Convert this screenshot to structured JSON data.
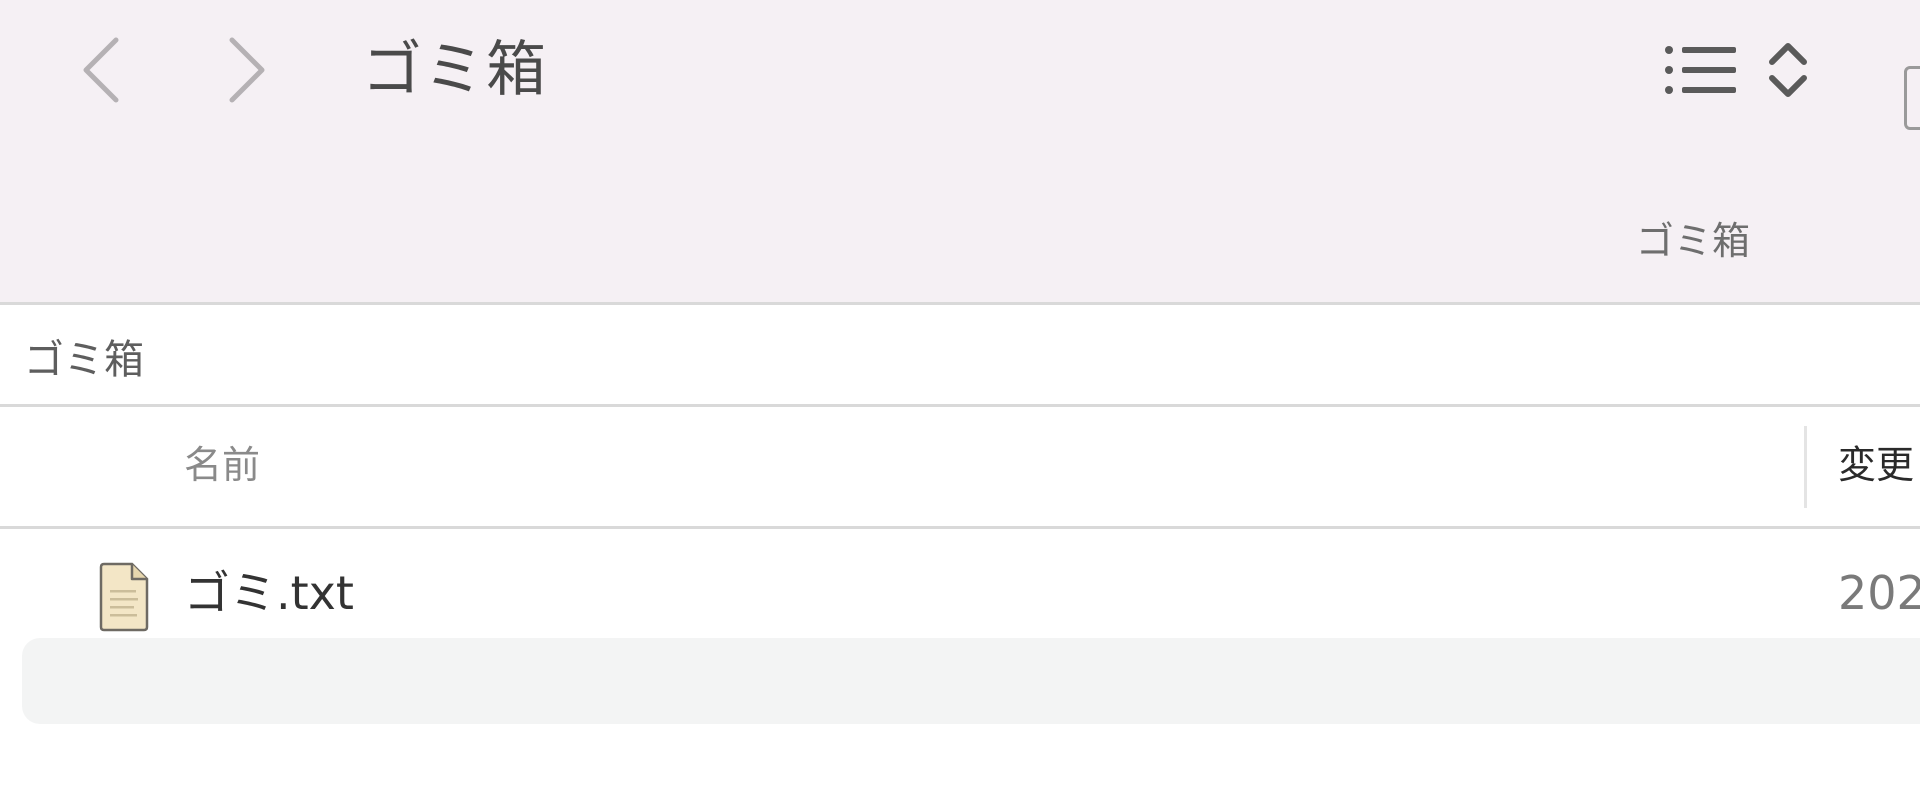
{
  "toolbar": {
    "title": "ゴミ箱",
    "location_label": "ゴミ箱",
    "back_icon": "chevron-left-icon",
    "forward_icon": "chevron-right-icon",
    "view_icon": "list-view-icon"
  },
  "path_bar": {
    "label": "ゴミ箱"
  },
  "columns": {
    "name": "名前",
    "modified": "変更"
  },
  "files": [
    {
      "name": "ゴミ.txt",
      "date": "202",
      "icon": "text-file-icon"
    }
  ],
  "colors": {
    "toolbar_bg": "#f5f0f4",
    "row_alt_bg": "#f3f4f4",
    "divider": "#d9d9d9"
  }
}
